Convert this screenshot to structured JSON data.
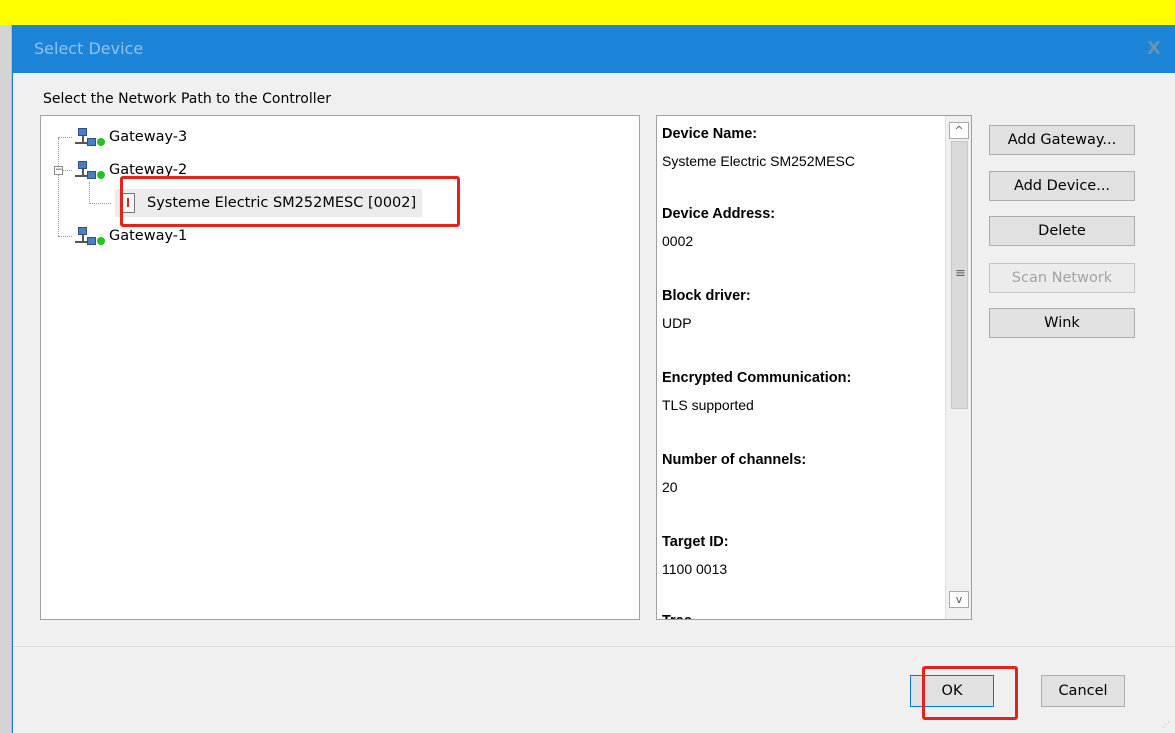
{
  "dialog": {
    "title": "Select Device",
    "close_glyph": "X",
    "prompt": "Select the Network Path to the Controller"
  },
  "tree": {
    "nodes": [
      {
        "label": "Gateway-3",
        "icon": "network-gateway-icon",
        "status": "online"
      },
      {
        "label": "Gateway-2",
        "icon": "network-gateway-icon",
        "status": "online",
        "expanded": true,
        "children": [
          {
            "label": "Systeme Electric SM252MESC [0002]",
            "icon": "controller-icon",
            "selected": true
          }
        ]
      },
      {
        "label": "Gateway-1",
        "icon": "network-gateway-icon",
        "status": "online"
      }
    ]
  },
  "device_info": {
    "fields": [
      {
        "heading": "Device Name:",
        "value": "Systeme Electric SM252MESC"
      },
      {
        "heading": "Device Address:",
        "value": "0002"
      },
      {
        "heading": "Block driver:",
        "value": "UDP"
      },
      {
        "heading": "Encrypted Communication:",
        "value": "TLS supported"
      },
      {
        "heading": "Number of channels:",
        "value": "20"
      },
      {
        "heading": "Target ID:",
        "value": "1100 0013"
      }
    ]
  },
  "actions": {
    "add_gateway": "Add Gateway...",
    "add_device": "Add Device...",
    "delete": "Delete",
    "scan_network": "Scan Network",
    "wink": "Wink"
  },
  "footer": {
    "ok": "OK",
    "cancel": "Cancel"
  },
  "colors": {
    "titlebar": "#1c85da",
    "highlight": "#e8211c",
    "status_online": "#21c421",
    "top_strip": "#ffff00"
  }
}
